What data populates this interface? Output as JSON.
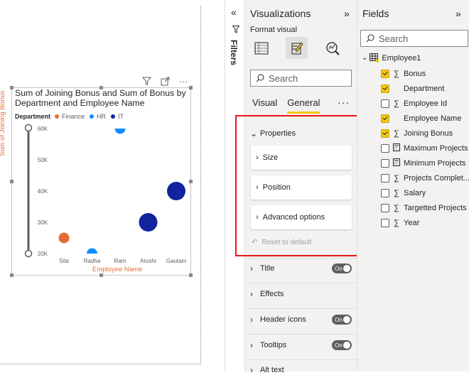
{
  "chart": {
    "title": "Sum of Joining Bonus and Sum of Bonus by Department and Employee Name",
    "legend_title": "Department",
    "legend": [
      {
        "label": "Finance",
        "color": "#e66c37"
      },
      {
        "label": "HR",
        "color": "#118dff"
      },
      {
        "label": "IT",
        "color": "#12239e"
      }
    ],
    "ylabel": "Sum of Joining Bonus",
    "xlabel": "Employee Name",
    "y_ticks": [
      "60K",
      "50K",
      "40K",
      "30K",
      "20K"
    ],
    "x_ticks": [
      "Sita",
      "Radha",
      "Ram",
      "Arushi",
      "Gautam"
    ]
  },
  "chart_data": {
    "type": "scatter",
    "title": "Sum of Joining Bonus and Sum of Bonus by Department and Employee Name",
    "xlabel": "Employee Name",
    "ylabel": "Sum of Joining Bonus",
    "categories": [
      "Sita",
      "Radha",
      "Ram",
      "Arushi",
      "Gautam"
    ],
    "ylim": [
      20000,
      60000
    ],
    "legend_position": "top-left",
    "grid": false,
    "series": [
      {
        "name": "Finance",
        "color": "#e66c37",
        "points": [
          {
            "x": "Sita",
            "y": 25000,
            "size": 1
          }
        ]
      },
      {
        "name": "HR",
        "color": "#118dff",
        "points": [
          {
            "x": "Radha",
            "y": 20000,
            "size": 1
          },
          {
            "x": "Ram",
            "y": 60000,
            "size": 1
          }
        ]
      },
      {
        "name": "IT",
        "color": "#12239e",
        "points": [
          {
            "x": "Arushi",
            "y": 30000,
            "size": 2.2
          },
          {
            "x": "Gautam",
            "y": 40000,
            "size": 2.2
          }
        ]
      }
    ]
  },
  "filters": {
    "label": "Filters"
  },
  "viz": {
    "title": "Visualizations",
    "format_label": "Format visual",
    "search_placeholder": "Search",
    "tabs": [
      "Visual",
      "General"
    ],
    "properties": "Properties",
    "cards": [
      "Size",
      "Position",
      "Advanced options"
    ],
    "reset": "Reset to default",
    "sections": [
      {
        "label": "Title",
        "toggle": "On"
      },
      {
        "label": "Effects",
        "toggle": ""
      },
      {
        "label": "Header icons",
        "toggle": "On"
      },
      {
        "label": "Tooltips",
        "toggle": "On"
      },
      {
        "label": "Alt text",
        "toggle": ""
      }
    ]
  },
  "fields": {
    "title": "Fields",
    "search_placeholder": "Search",
    "table": "Employee1",
    "items": [
      {
        "label": "Bonus",
        "checked": true,
        "icon": "sigma"
      },
      {
        "label": "Department",
        "checked": true,
        "icon": "none"
      },
      {
        "label": "Employee Id",
        "checked": false,
        "icon": "sigma"
      },
      {
        "label": "Employee Name",
        "checked": true,
        "icon": "none"
      },
      {
        "label": "Joining Bonus",
        "checked": true,
        "icon": "sigma"
      },
      {
        "label": "Maximum Projects",
        "checked": false,
        "icon": "calc"
      },
      {
        "label": "Minimum Projects",
        "checked": false,
        "icon": "calc"
      },
      {
        "label": "Projects Complet...",
        "checked": false,
        "icon": "sigma"
      },
      {
        "label": "Salary",
        "checked": false,
        "icon": "sigma"
      },
      {
        "label": "Targetted Projects",
        "checked": false,
        "icon": "sigma"
      },
      {
        "label": "Year",
        "checked": false,
        "icon": "sigma"
      }
    ]
  }
}
